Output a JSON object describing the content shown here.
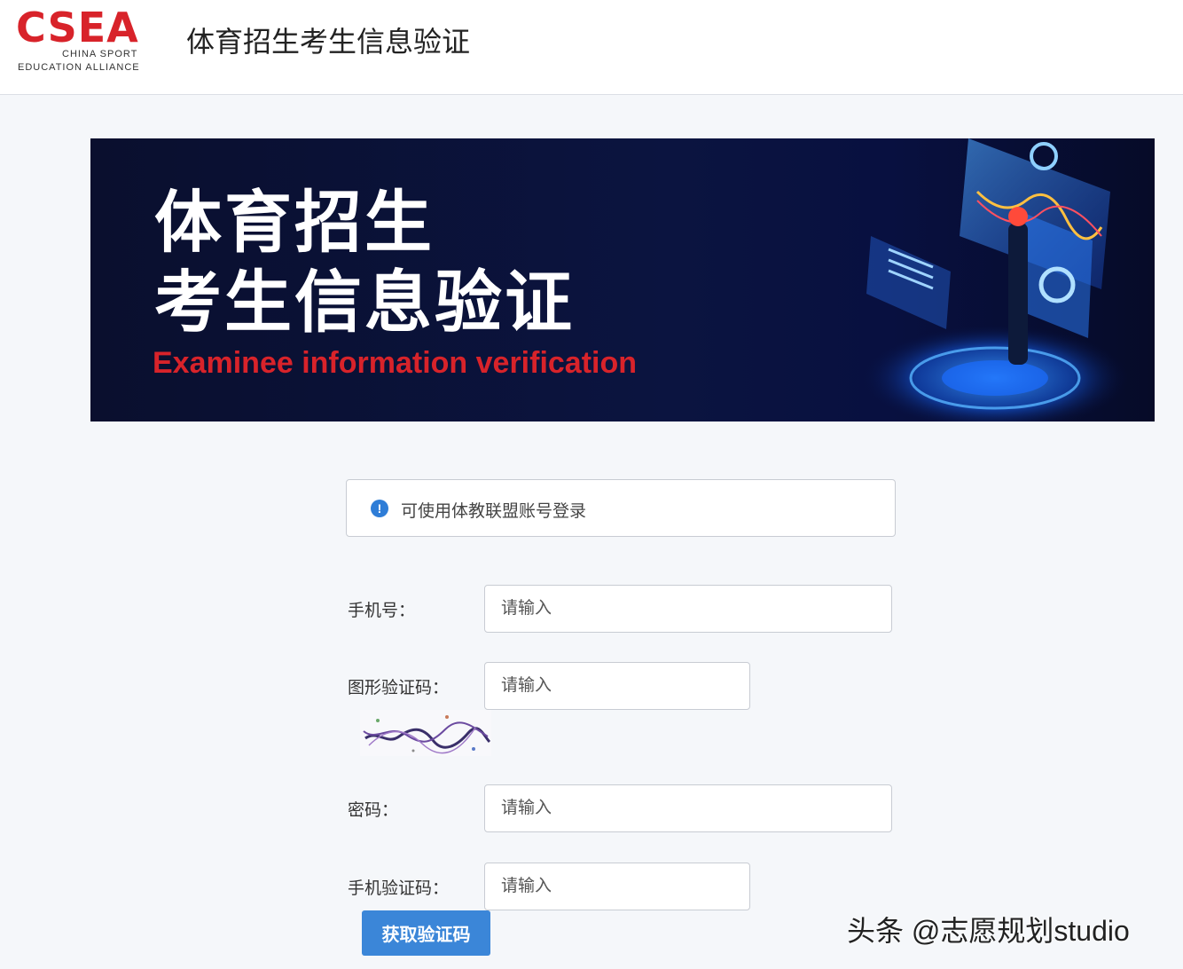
{
  "header": {
    "logo_main": "CSEA",
    "logo_sub1": "CHINA SPORT",
    "logo_sub2": "EDUCATION ALLIANCE",
    "title": "体育招生考生信息验证"
  },
  "banner": {
    "line1": "体育招生",
    "line2": "考生信息验证",
    "english": "Examinee information verification"
  },
  "notice": {
    "icon": "info-icon",
    "text": "可使用体教联盟账号登录"
  },
  "form": {
    "phone_label": "手机号：",
    "phone_placeholder": "请输入",
    "captcha_label": "图形验证码：",
    "captcha_placeholder": "请输入",
    "password_label": "密码：",
    "password_placeholder": "请输入",
    "sms_label": "手机验证码：",
    "sms_placeholder": "请输入",
    "sms_button": "获取验证码"
  },
  "watermark": "头条 @志愿规划studio",
  "colors": {
    "brand_red": "#d8232a",
    "primary_blue": "#3b86d8",
    "banner_bg": "#0b1440"
  }
}
